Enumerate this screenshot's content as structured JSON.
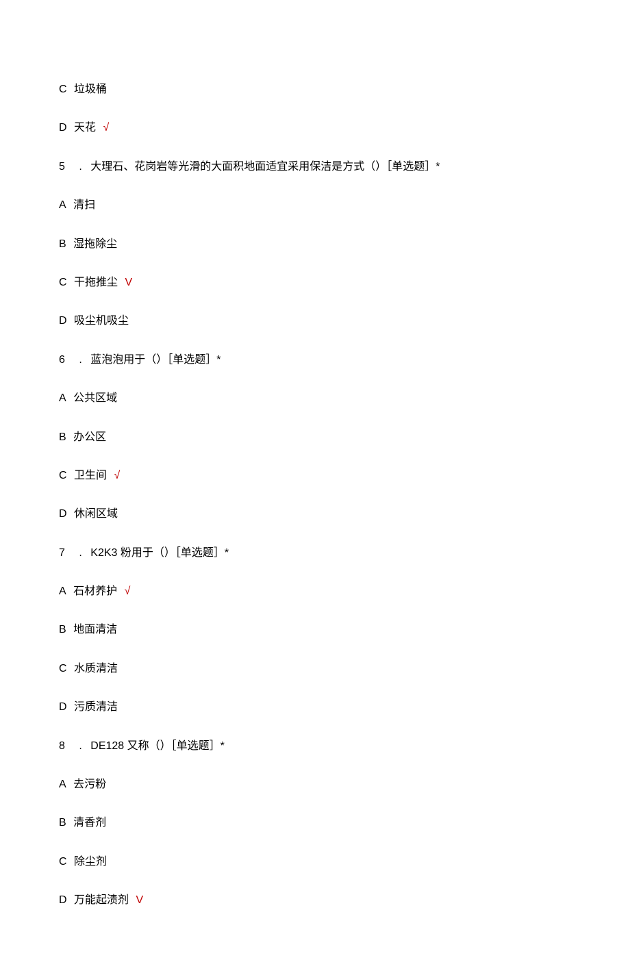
{
  "lines": {
    "optC_prev": {
      "label": "C",
      "text": "垃圾桶",
      "mark": ""
    },
    "optD_prev": {
      "label": "D",
      "text": "天花",
      "mark": "√"
    },
    "q5": {
      "num": "5",
      "dot": ".",
      "text": "大理石、花岗岩等光滑的大面积地面适宜采用保洁是方式（）［单选题］*"
    },
    "q5A": {
      "label": "A",
      "text": "清扫",
      "mark": ""
    },
    "q5B": {
      "label": "B",
      "text": "湿拖除尘",
      "mark": ""
    },
    "q5C": {
      "label": "C",
      "text": "干拖推尘",
      "mark": "V"
    },
    "q5D": {
      "label": "D",
      "text": "吸尘机吸尘",
      "mark": ""
    },
    "q6": {
      "num": "6",
      "dot": ".",
      "text": "蓝泡泡用于（）［单选题］*"
    },
    "q6A": {
      "label": "A",
      "text": "公共区域",
      "mark": ""
    },
    "q6B": {
      "label": "B",
      "text": "办公区",
      "mark": ""
    },
    "q6C": {
      "label": "C",
      "text": "卫生间",
      "mark": "√"
    },
    "q6D": {
      "label": "D",
      "text": "休闲区域",
      "mark": ""
    },
    "q7": {
      "num": "7",
      "dot": ".",
      "text": "K2K3 粉用于（）［单选题］*"
    },
    "q7A": {
      "label": "A",
      "text": "石材养护",
      "mark": "√"
    },
    "q7B": {
      "label": "B",
      "text": "地面清洁",
      "mark": ""
    },
    "q7C": {
      "label": "C",
      "text": "水质清洁",
      "mark": ""
    },
    "q7D": {
      "label": "D",
      "text": "污质清洁",
      "mark": ""
    },
    "q8": {
      "num": "8",
      "dot": ".",
      "text": "DE128 又称（）［单选题］*"
    },
    "q8A": {
      "label": "A",
      "text": "去污粉",
      "mark": ""
    },
    "q8B": {
      "label": "B",
      "text": "清香剂",
      "mark": ""
    },
    "q8C": {
      "label": "C",
      "text": "除尘剂",
      "mark": ""
    },
    "q8D": {
      "label": "D",
      "text": "万能起渍剂",
      "mark": "V"
    }
  }
}
